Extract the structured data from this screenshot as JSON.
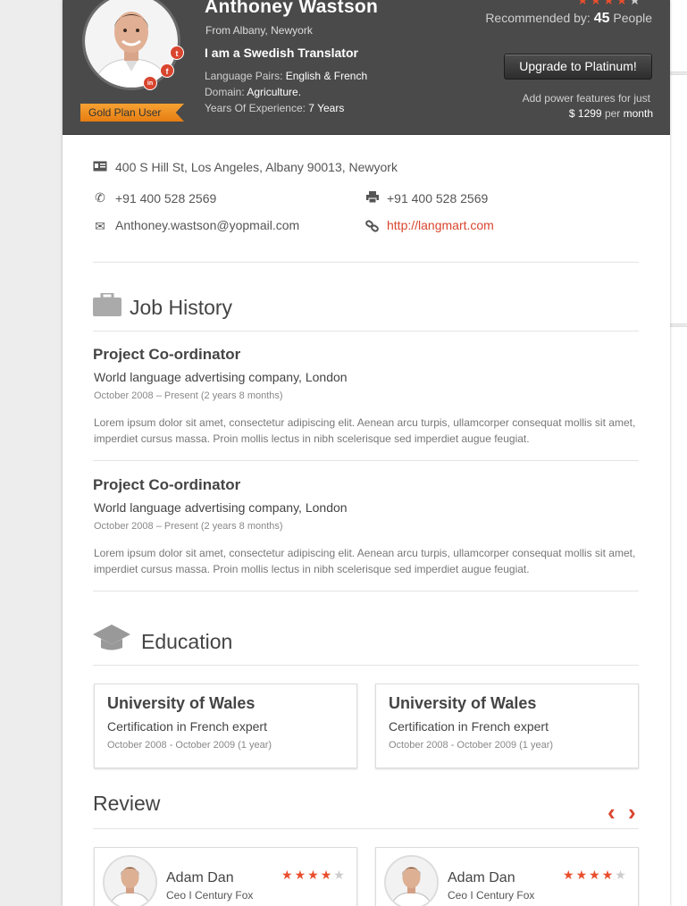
{
  "profile": {
    "name": "Anthoney Wastson",
    "from": "From Albany, Newyork",
    "tagline": "I am a Swedish Translator",
    "language_label": "Language Pairs:",
    "language_value": "English & French",
    "domain_label": "Domain:",
    "domain_value": "Agriculture.",
    "experience_label": "Years Of Experience:",
    "experience_value": "7 Years",
    "plan_badge": "Gold Plan User",
    "rating": 4,
    "rating_max": 5
  },
  "social": {
    "twitter": "t",
    "facebook": "f",
    "linkedin": "in"
  },
  "recommend": {
    "prefix": "Recommended by:",
    "count": "45",
    "suffix": "People"
  },
  "upgrade": {
    "button_label": "Upgrade to Platinum!",
    "note": "Add power features for just",
    "price": "$ 1299",
    "per": "per",
    "period": "month"
  },
  "contact": {
    "address": "400 S Hill St, Los Angeles, Albany 90013, Newyork",
    "phone": "+91 400 528 2569",
    "fax": "+91 400 528 2569",
    "email": "Anthoney.wastson@yopmail.com",
    "website": "http://langmart.com"
  },
  "job_history": {
    "title": "Job History",
    "items": [
      {
        "title": "Project Co-ordinator",
        "company": "World language advertising company, London",
        "dates": "October 2008 – Present (2 years 8 months)",
        "description": "Lorem ipsum dolor sit amet, consectetur adipiscing elit. Aenean arcu turpis, ullamcorper consequat mollis sit amet, imperdiet cursus massa. Proin mollis lectus in nibh scelerisque sed imperdiet augue feugiat."
      },
      {
        "title": "Project Co-ordinator",
        "company": "World language advertising company, London",
        "dates": "October 2008 – Present (2 years 8 months)",
        "description": "Lorem ipsum dolor sit amet, consectetur adipiscing elit. Aenean arcu turpis, ullamcorper consequat mollis sit amet, imperdiet cursus massa. Proin mollis lectus in nibh scelerisque sed imperdiet augue feugiat."
      }
    ]
  },
  "education": {
    "title": "Education",
    "items": [
      {
        "university": "University of Wales",
        "certification": "Certification in French expert",
        "dates": "October 2008 - October 2009 (1 year)"
      },
      {
        "university": "University of Wales",
        "certification": "Certification in French expert",
        "dates": "October 2008 - October 2009 (1 year)"
      }
    ]
  },
  "review": {
    "title": "Review",
    "prev": "‹",
    "next": "›",
    "items": [
      {
        "name": "Adam Dan",
        "role": "Ceo I Century Fox",
        "rating": 4
      },
      {
        "name": "Adam Dan",
        "role": "Ceo I Century Fox",
        "rating": 4
      }
    ]
  },
  "colors": {
    "accent": "#d9452e",
    "header_bg": "#4a4a4a",
    "badge": "#f39a2b"
  }
}
